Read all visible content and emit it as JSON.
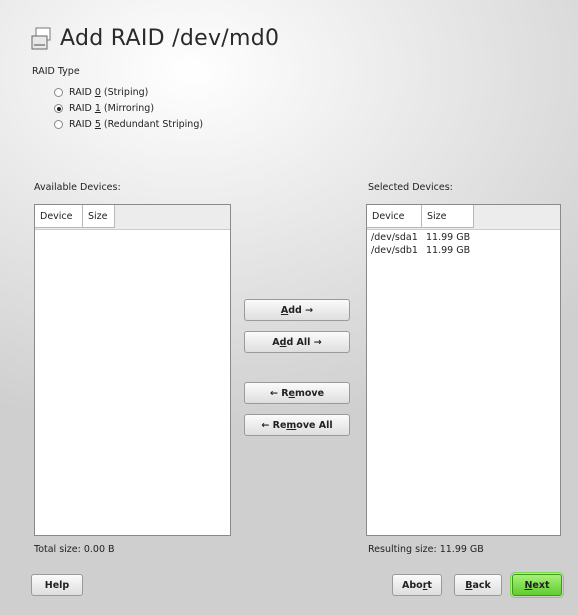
{
  "title": "Add RAID /dev/md0",
  "raid_type_label": "RAID Type",
  "raid_options": [
    {
      "pre": "RAID ",
      "key": "0",
      "post": " (Striping)",
      "checked": false
    },
    {
      "pre": "RAID ",
      "key": "1",
      "post": " (Mirroring)",
      "checked": true
    },
    {
      "pre": "RAID ",
      "key": "5",
      "post": " (Redundant Striping)",
      "checked": false
    }
  ],
  "available": {
    "label": "Available Devices:",
    "columns": [
      "Device",
      "Size"
    ],
    "rows": [],
    "total_label": "Total size: 0.00 B"
  },
  "selected": {
    "label": "Selected Devices:",
    "columns": [
      "Device",
      "Size"
    ],
    "rows": [
      {
        "device": "/dev/sda1",
        "size": "11.99 GB"
      },
      {
        "device": "/dev/sdb1",
        "size": "11.99 GB"
      }
    ],
    "total_label": "Resulting size: 11.99 GB"
  },
  "buttons": {
    "add": {
      "pre": "",
      "key": "A",
      "post": "dd →"
    },
    "add_all": {
      "pre": "A",
      "key": "d",
      "post": "d All →"
    },
    "remove": {
      "pre": "← R",
      "key": "e",
      "post": "move"
    },
    "remove_all": {
      "pre": "← Re",
      "key": "m",
      "post": "ove All"
    },
    "help": "Help",
    "abort": {
      "pre": "Abo",
      "key": "r",
      "post": "t"
    },
    "back": {
      "pre": "",
      "key": "B",
      "post": "ack"
    },
    "next": {
      "pre": "",
      "key": "N",
      "post": "ext"
    }
  },
  "icons": {
    "title": "hard-drive-icon"
  },
  "colors": {
    "next_button": "#5fcd2c"
  }
}
